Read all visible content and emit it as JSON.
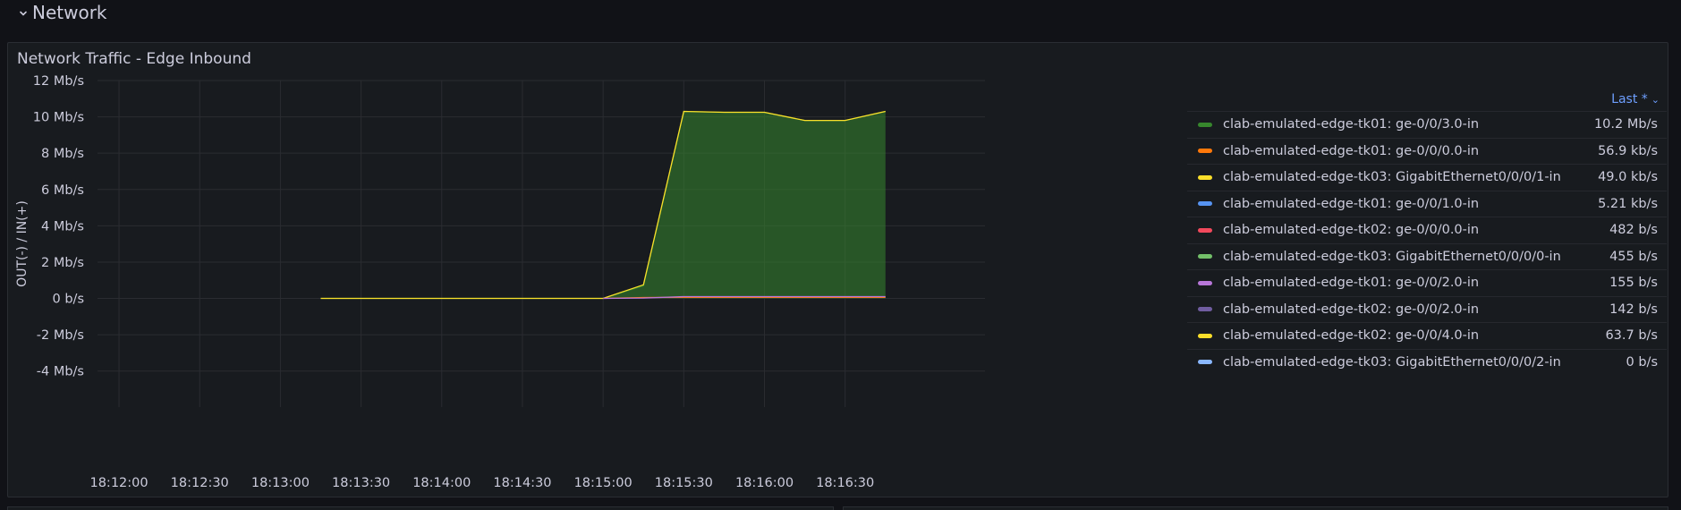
{
  "row": {
    "title": "Network"
  },
  "panel": {
    "title": "Network Traffic - Edge Inbound"
  },
  "legend": {
    "sort_label": "Last *",
    "items": [
      {
        "label": "clab-emulated-edge-tk01: ge-0/0/3.0-in",
        "value": "10.2 Mb/s",
        "color": "#37872d"
      },
      {
        "label": "clab-emulated-edge-tk01: ge-0/0/0.0-in",
        "value": "56.9 kb/s",
        "color": "#ff780a"
      },
      {
        "label": "clab-emulated-edge-tk03: GigabitEthernet0/0/0/1-in",
        "value": "49.0 kb/s",
        "color": "#fade2a"
      },
      {
        "label": "clab-emulated-edge-tk01: ge-0/0/1.0-in",
        "value": "5.21 kb/s",
        "color": "#5794f2"
      },
      {
        "label": "clab-emulated-edge-tk02: ge-0/0/0.0-in",
        "value": "482 b/s",
        "color": "#f2495c"
      },
      {
        "label": "clab-emulated-edge-tk03: GigabitEthernet0/0/0/0-in",
        "value": "455 b/s",
        "color": "#73bf69"
      },
      {
        "label": "clab-emulated-edge-tk01: ge-0/0/2.0-in",
        "value": "155 b/s",
        "color": "#b877d9"
      },
      {
        "label": "clab-emulated-edge-tk02: ge-0/0/2.0-in",
        "value": "142 b/s",
        "color": "#705da0"
      },
      {
        "label": "clab-emulated-edge-tk02: ge-0/0/4.0-in",
        "value": "63.7 b/s",
        "color": "#fade2a"
      },
      {
        "label": "clab-emulated-edge-tk03: GigabitEthernet0/0/0/2-in",
        "value": "0 b/s",
        "color": "#8ab8ff"
      }
    ]
  },
  "chart_data": {
    "type": "area",
    "ylabel": "OUT(-) / IN(+)",
    "y_ticks": [
      12,
      10,
      8,
      6,
      4,
      2,
      0,
      -2,
      -4
    ],
    "y_tick_labels": [
      "12 Mb/s",
      "10 Mb/s",
      "8 Mb/s",
      "6 Mb/s",
      "4 Mb/s",
      "2 Mb/s",
      "0 b/s",
      "-2 Mb/s",
      "-4 Mb/s"
    ],
    "ylim": [
      -5,
      12
    ],
    "x_tick_labels": [
      "18:12:00",
      "18:12:30",
      "18:13:00",
      "18:13:30",
      "18:14:00",
      "18:14:30",
      "18:15:00",
      "18:15:30",
      "18:16:00",
      "18:16:30"
    ],
    "x_tick_seconds": [
      0,
      30,
      60,
      90,
      120,
      150,
      180,
      210,
      240,
      270
    ],
    "xlim_seconds": [
      -8,
      322
    ],
    "grid": true,
    "legend_position": "right",
    "series": [
      {
        "name": "clab-emulated-edge-tk01: ge-0/0/3.0-in",
        "color": "#37872d",
        "fill": true,
        "x_seconds": [
          75,
          90,
          105,
          120,
          135,
          150,
          165,
          180,
          195,
          210,
          225,
          240,
          255,
          270,
          285
        ],
        "values": [
          0,
          0,
          0,
          0,
          0,
          0,
          0,
          0,
          0.7,
          10.3,
          10.25,
          10.25,
          9.8,
          9.8,
          10.3
        ]
      },
      {
        "name": "clab-emulated-edge-tk03: GigabitEthernet0/0/0/1-in",
        "color": "#fade2a",
        "fill": false,
        "x_seconds": [
          75,
          90,
          105,
          120,
          135,
          150,
          165,
          180,
          195,
          210,
          225,
          240,
          255,
          270,
          285
        ],
        "values": [
          0,
          0,
          0,
          0,
          0,
          0,
          0,
          0,
          0.75,
          10.3,
          10.25,
          10.25,
          9.8,
          9.8,
          10.3
        ]
      },
      {
        "name": "clab-emulated-edge-tk01: ge-0/0/0.0-in",
        "color": "#ff780a",
        "fill": false,
        "x_seconds": [
          180,
          195,
          210,
          225,
          240,
          255,
          270,
          285
        ],
        "values": [
          0,
          0.05,
          0.06,
          0.06,
          0.06,
          0.06,
          0.06,
          0.06
        ]
      },
      {
        "name": "clab-emulated-edge-tk01: ge-0/0/2.0-in",
        "color": "#b877d9",
        "fill": false,
        "x_seconds": [
          180,
          195,
          210,
          225,
          240,
          255,
          270,
          285
        ],
        "values": [
          0,
          0.02,
          0.1,
          0.1,
          0.1,
          0.1,
          0.1,
          0.1
        ]
      }
    ]
  }
}
